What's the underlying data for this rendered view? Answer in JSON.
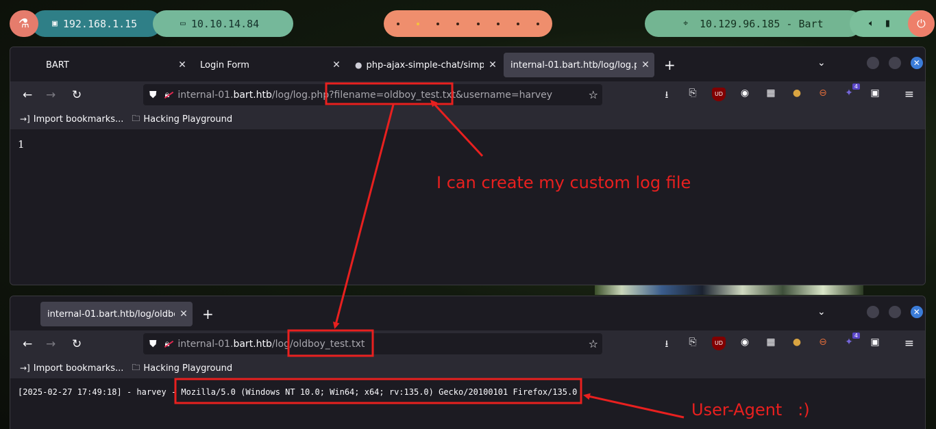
{
  "panel": {
    "local_ip": "192.168.1.15",
    "vpn_ip": "10.10.14.84",
    "target": "10.129.96.185 - Bart",
    "workspace_count": 8,
    "active_workspace": 2
  },
  "window_top": {
    "tabs": [
      {
        "label": "BART"
      },
      {
        "label": "Login Form"
      },
      {
        "label": "php-ajax-simple-chat/simp"
      },
      {
        "label": "internal-01.bart.htb/log/log.ph"
      }
    ],
    "url": {
      "prefix": "internal-01.",
      "host": "bart.htb",
      "path": "/log/log.php",
      "query": "?filename=oldboy_test.txt&username=harvey"
    },
    "bookmarks": [
      "Import bookmarks...",
      "Hacking Playground"
    ],
    "content": "1"
  },
  "window_bottom": {
    "tabs": [
      {
        "label": "internal-01.bart.htb/log/oldbo"
      }
    ],
    "url": {
      "prefix": "internal-01.",
      "host": "bart.htb",
      "path": "/log/oldboy_test.txt"
    },
    "bookmarks": [
      "Import bookmarks...",
      "Hacking Playground"
    ],
    "log_prefix": "[2025-02-27 17:49:18] - harvey - ",
    "log_useragent": "Mozilla/5.0 (Windows NT 10.0; Win64; x64; rv:135.0) Gecko/20100101 Firefox/135.0"
  },
  "extensions": {
    "ublock_label": "UD",
    "badge_count": "4"
  },
  "annotations": {
    "note1": "I can create my custom log file",
    "note2": "User-Agent   :)",
    "color": "#e8201f"
  }
}
